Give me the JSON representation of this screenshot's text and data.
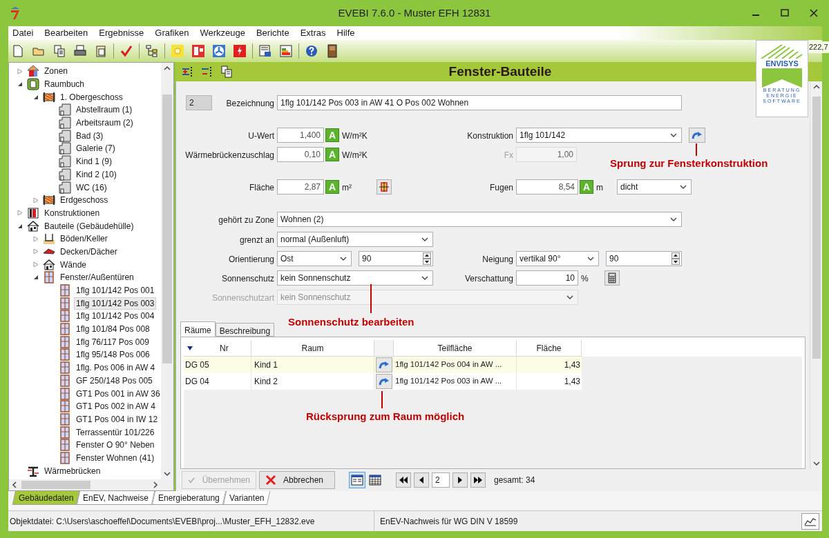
{
  "window": {
    "title": "EVEBI 7.6.0 - Muster EFH 12831"
  },
  "menu": [
    "Datei",
    "Bearbeiten",
    "Ergebnisse",
    "Grafiken",
    "Werkzeuge",
    "Berichte",
    "Extras",
    "Hilfe"
  ],
  "logo": {
    "name": "ENVISYS",
    "tagline": [
      "BERATUNG",
      "ENERGIE",
      "SOFTWARE"
    ]
  },
  "corner_value": "222,7",
  "tree": [
    {
      "label": "Zonen",
      "kind": "zone",
      "expanded": false,
      "selected": false
    },
    {
      "label": "Raumbuch",
      "kind": "book",
      "expanded": true,
      "selected": false,
      "children": [
        {
          "label": "1. Obergeschoss",
          "kind": "floor",
          "expanded": true,
          "selected": false,
          "children": [
            {
              "label": "Abstellraum (1)",
              "kind": "room",
              "selected": false
            },
            {
              "label": "Arbeitsraum (2)",
              "kind": "room",
              "selected": false
            },
            {
              "label": "Bad (3)",
              "kind": "room",
              "selected": false
            },
            {
              "label": "Galerie (7)",
              "kind": "room",
              "selected": false
            },
            {
              "label": "Kind 1 (9)",
              "kind": "room",
              "selected": false
            },
            {
              "label": "Kind 2 (10)",
              "kind": "room",
              "selected": false
            },
            {
              "label": "WC (16)",
              "kind": "room",
              "selected": false
            }
          ]
        },
        {
          "label": "Erdgeschoss",
          "kind": "floor",
          "expanded": false,
          "selected": false
        }
      ]
    },
    {
      "label": "Konstruktionen",
      "kind": "construction",
      "expanded": false,
      "selected": false
    },
    {
      "label": "Bauteile (Gebäudehülle)",
      "kind": "house",
      "expanded": true,
      "selected": false,
      "children": [
        {
          "label": "Böden/Keller",
          "kind": "slab",
          "expanded": false,
          "selected": false
        },
        {
          "label": "Decken/Dächer",
          "kind": "roof",
          "expanded": false,
          "selected": false
        },
        {
          "label": "Wände",
          "kind": "house",
          "expanded": false,
          "selected": false
        },
        {
          "label": "Fenster/Außentüren",
          "kind": "window",
          "expanded": true,
          "selected": false,
          "children": [
            {
              "label": "1flg 101/142 Pos 001",
              "kind": "window",
              "selected": false
            },
            {
              "label": "1flg 101/142 Pos 003",
              "kind": "window",
              "selected": true
            },
            {
              "label": "1flg 101/142 Pos 004",
              "kind": "window",
              "selected": false
            },
            {
              "label": "1flg 101/84 Pos 008",
              "kind": "window",
              "selected": false
            },
            {
              "label": "1flg 76/117 Pos 009",
              "kind": "window",
              "selected": false
            },
            {
              "label": "1flg 95/148 Pos 006",
              "kind": "window",
              "selected": false
            },
            {
              "label": "1flg. Pos 006 in AW 4",
              "kind": "window",
              "selected": false
            },
            {
              "label": "GF 250/148 Pos 005",
              "kind": "window",
              "selected": false
            },
            {
              "label": "GT1 Pos 001 in AW 36",
              "kind": "window",
              "selected": false
            },
            {
              "label": "GT1 Pos 002 in AW 4",
              "kind": "window",
              "selected": false
            },
            {
              "label": "GT1 Pos 004 in IW 12",
              "kind": "window",
              "selected": false
            },
            {
              "label": "Terrassentür 101/226",
              "kind": "window",
              "selected": false
            },
            {
              "label": "Fenster O 90° Neben",
              "kind": "window",
              "selected": false
            },
            {
              "label": "Fenster Wohnen (41)",
              "kind": "window",
              "selected": false
            }
          ]
        }
      ]
    },
    {
      "label": "Wärmebrücken",
      "kind": "bridge",
      "selected": false
    }
  ],
  "panel": {
    "title": "Fenster-Bauteile"
  },
  "form": {
    "index": "2",
    "bezeichnung": {
      "label": "Bezeichnung",
      "value": "1flg 101/142 Pos 003 in AW 41 O Pos 002 Wohnen"
    },
    "u_wert": {
      "label": "U-Wert",
      "value": "1,400",
      "auto": "A",
      "unit": "W/m²K"
    },
    "waermebruecke": {
      "label": "Wärmebrückenzuschlag",
      "value": "0,10",
      "auto": "A",
      "unit": "W/m²K"
    },
    "flaeche": {
      "label": "Fläche",
      "value": "2,87",
      "auto": "A",
      "unit": "m²"
    },
    "konstruktion": {
      "label": "Konstruktion",
      "value": "1flg 101/142"
    },
    "fx": {
      "label": "Fx",
      "value": "1,00",
      "disabled": true
    },
    "fugen": {
      "label": "Fugen",
      "value": "8,54",
      "auto": "A",
      "unit": "m",
      "option": "dicht"
    },
    "zone": {
      "label": "gehört zu Zone",
      "value": "Wohnen (2)"
    },
    "grenzt_an": {
      "label": "grenzt an",
      "value": "normal (Außenluft)"
    },
    "orientierung": {
      "label": "Orientierung",
      "value": "Ost",
      "angle": "90"
    },
    "neigung": {
      "label": "Neigung",
      "value": "vertikal 90°",
      "angle": "90"
    },
    "sonnenschutz": {
      "label": "Sonnenschutz",
      "value": "kein Sonnenschutz"
    },
    "verschattung": {
      "label": "Verschattung",
      "value": "10",
      "unit": "%"
    },
    "sonnenschutzart": {
      "label": "Sonnenschutzart",
      "value": "kein Sonnenschutz",
      "disabled": true
    }
  },
  "annotations": [
    "Sprung zur Fensterkonstruktion",
    "Sonnenschutz bearbeiten",
    "Rücksprung zum Raum möglich"
  ],
  "tabs": [
    {
      "label": "Räume",
      "selected": true
    },
    {
      "label": "Beschreibung",
      "selected": false
    }
  ],
  "table": {
    "columns": [
      "Nr",
      "Raum",
      "Teilfläche",
      "Fläche"
    ],
    "rows": [
      {
        "nr": "DG 05",
        "raum": "Kind 1",
        "teilflaeche": "1flg 101/142 Pos 004 in AW ...",
        "flaeche": "1,43",
        "selected": true
      },
      {
        "nr": "DG 04",
        "raum": "Kind 2",
        "teilflaeche": "1flg 101/142 Pos 003 in AW ...",
        "flaeche": "1,43",
        "selected": false
      }
    ]
  },
  "buttons": [
    {
      "label": "Übernehmen",
      "kind": "apply",
      "disabled": true
    },
    {
      "label": "Abbrechen",
      "kind": "cancel",
      "disabled": false
    }
  ],
  "views": [
    {
      "kind": "form",
      "selected": true
    },
    {
      "kind": "grid",
      "selected": false
    }
  ],
  "pager": {
    "value": "2",
    "total": "gesamt: 34"
  },
  "bottom_tabs": [
    {
      "label": "Gebäudedaten",
      "selected": true
    },
    {
      "label": "EnEV, Nachweise",
      "selected": false
    },
    {
      "label": "Energieberatung",
      "selected": false
    },
    {
      "label": "Varianten",
      "selected": false
    }
  ],
  "status_bar": {
    "file": "Objektdatei: C:\\Users\\aschoeffel\\Documents\\EVEBI\\proj...\\Muster_EFH_12832.eve",
    "mode": "EnEV-Nachweis für WG DIN V 18599"
  }
}
